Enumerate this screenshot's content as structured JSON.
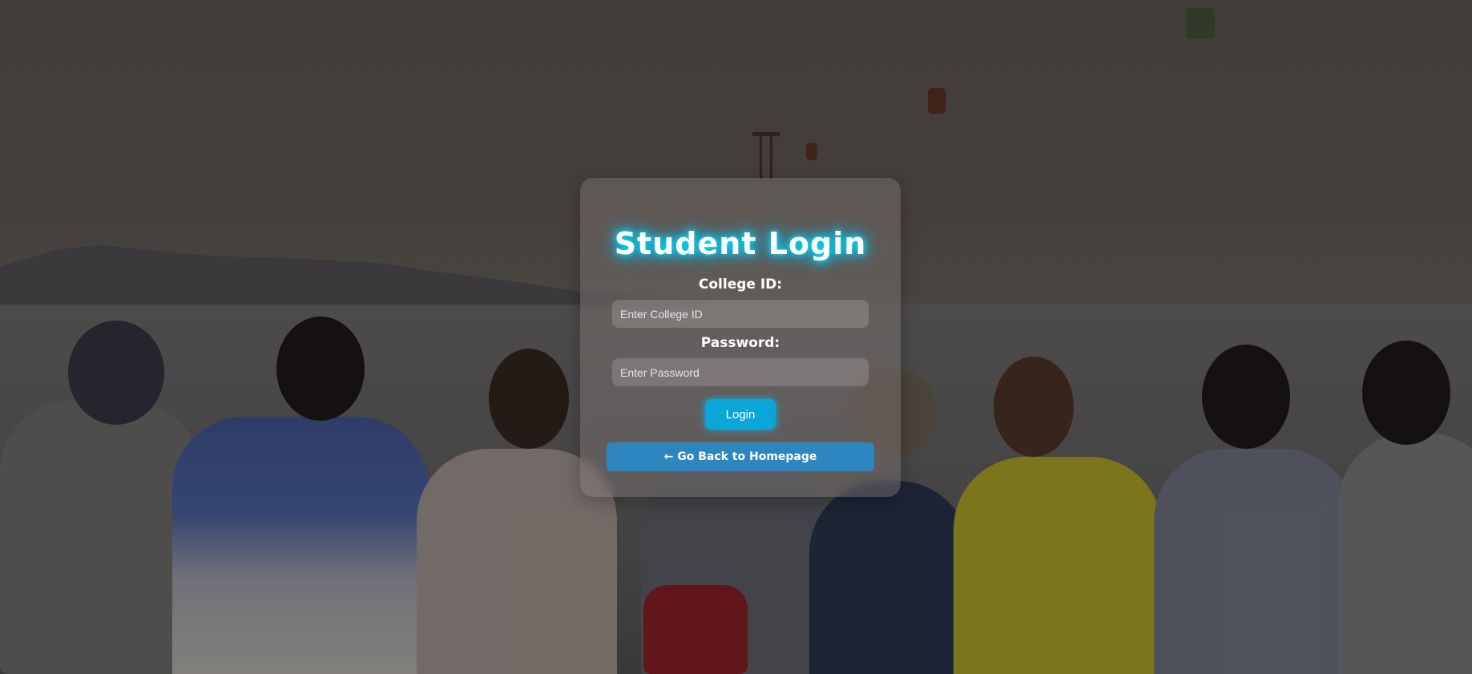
{
  "page": {
    "accent": "#00e5ff",
    "login_button_color": "#0aa6d8",
    "back_button_color": "#2e86c1"
  },
  "login_card": {
    "title": "Student Login",
    "college_id_label": "College ID:",
    "college_id_placeholder": "Enter College ID",
    "password_label": "Password:",
    "password_placeholder": "Enter Password",
    "login_button": "Login",
    "back_button": "← Go Back to Homepage"
  }
}
